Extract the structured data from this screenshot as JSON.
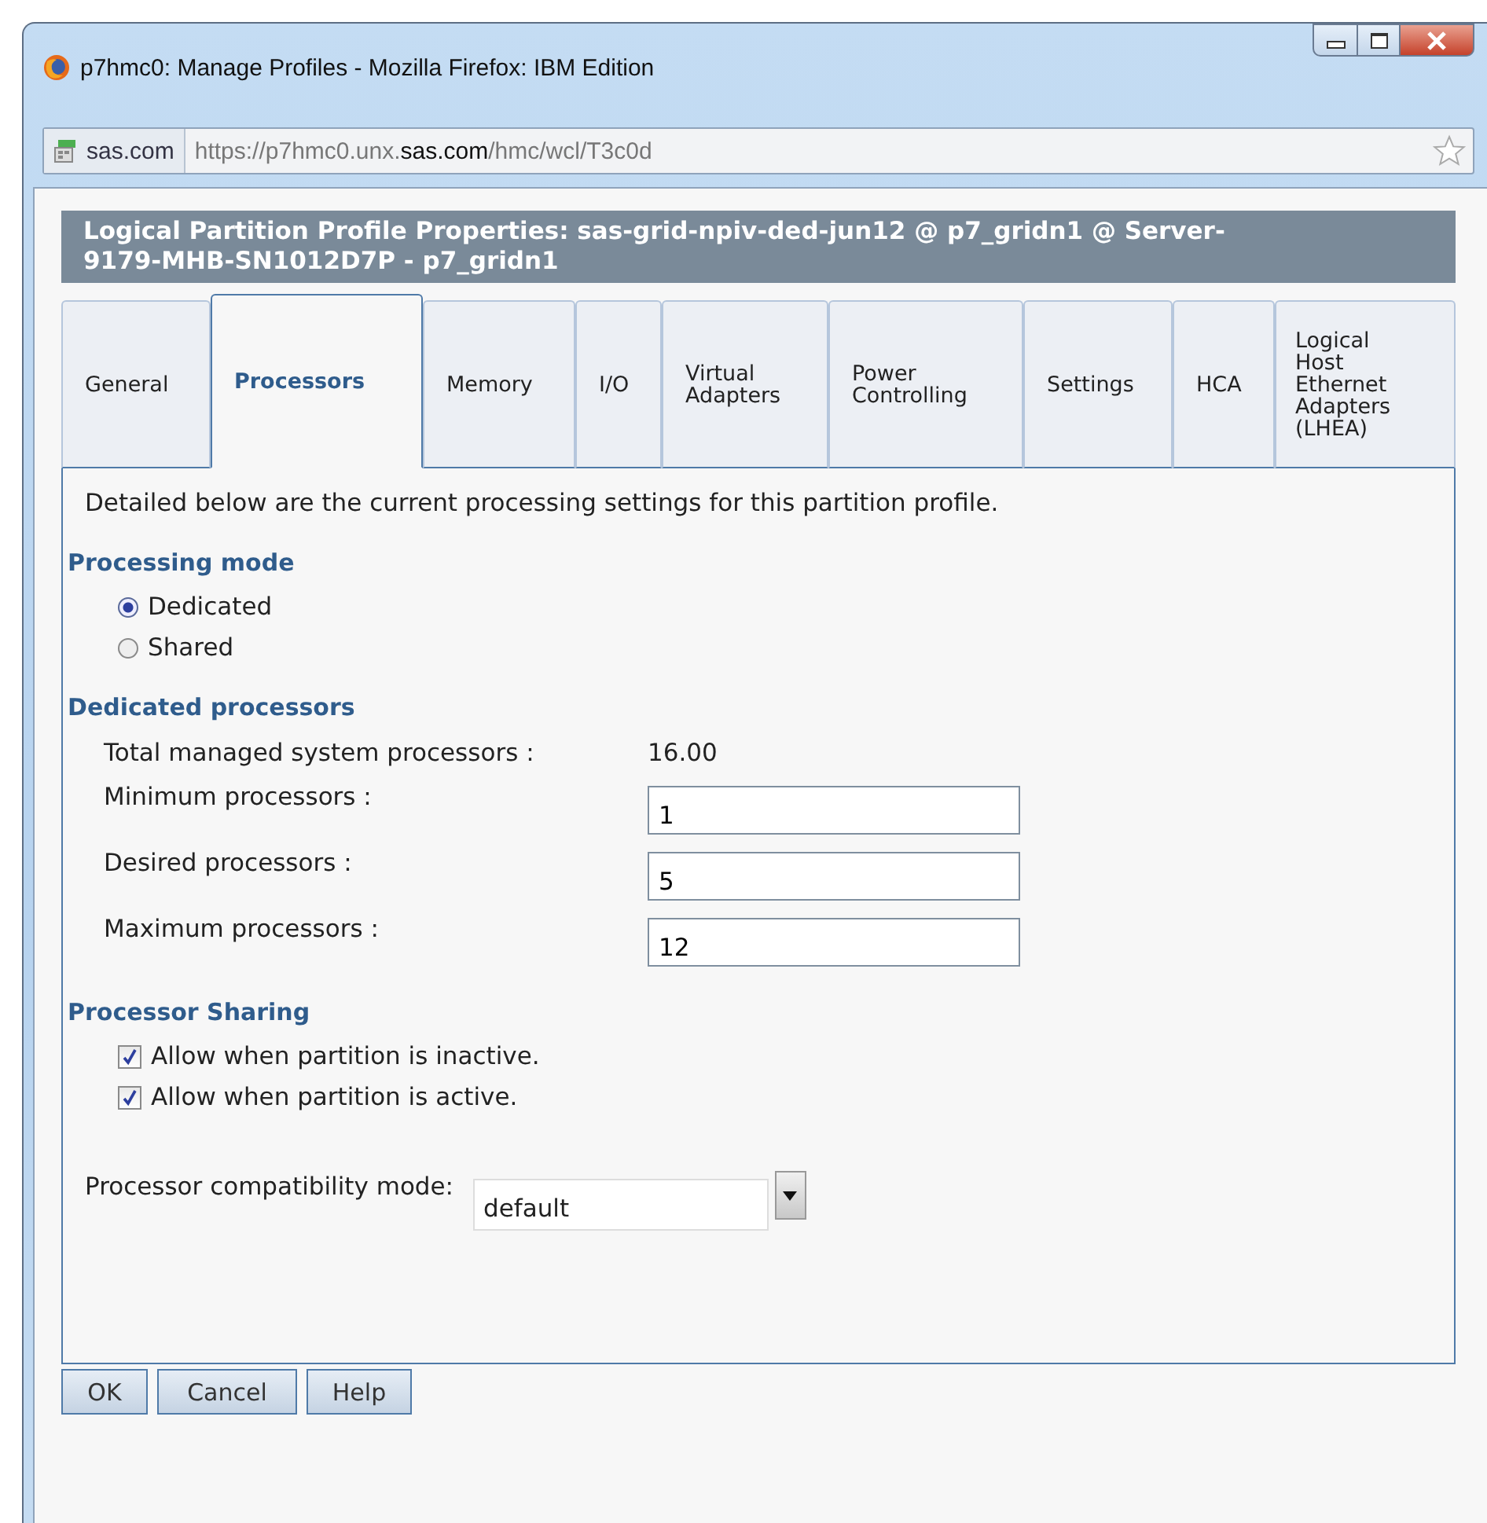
{
  "window": {
    "title": "p7hmc0: Manage Profiles - Mozilla Firefox: IBM Edition"
  },
  "address_bar": {
    "site": "sas.com",
    "url": "https://p7hmc0.unx.**sas.com**/hmc/wcl/T3c0d"
  },
  "header": "Logical Partition Profile Properties: sas-grid-npiv-ded-jun12 @ p7_gridn1 @ Server-9179-MHB-SN1012D7P - p7_gridn1",
  "tabs": [
    {
      "label": "General",
      "selected": false
    },
    {
      "label": "Processors",
      "selected": true
    },
    {
      "label": "Memory",
      "selected": false
    },
    {
      "label": "I/O",
      "selected": false
    },
    {
      "label": "Virtual Adapters",
      "selected": false
    },
    {
      "label": "Power Controlling",
      "selected": false
    },
    {
      "label": "Settings",
      "selected": false
    },
    {
      "label": "HCA",
      "selected": false
    },
    {
      "label": "Logical Host Ethernet Adapters (LHEA)",
      "selected": false
    }
  ],
  "intro": "Detailed below are the current processing settings for this partition profile.",
  "processing_mode": {
    "heading": "Processing mode",
    "options": [
      {
        "label": "Dedicated",
        "selected": true
      },
      {
        "label": "Shared",
        "selected": false
      }
    ]
  },
  "dedicated_processors": {
    "heading": "Dedicated processors",
    "total_label": "Total managed system processors :",
    "total_value": "16.00",
    "fields": [
      {
        "label": "Minimum processors :",
        "value": "1"
      },
      {
        "label": "Desired processors :",
        "value": "5"
      },
      {
        "label": "Maximum processors :",
        "value": "12"
      }
    ]
  },
  "processor_sharing": {
    "heading": "Processor Sharing",
    "options": [
      {
        "label": "Allow when partition is inactive.",
        "checked": true
      },
      {
        "label": "Allow when partition is active.",
        "checked": true
      }
    ]
  },
  "compatibility": {
    "label": "Processor compatibility mode:",
    "value": "default"
  },
  "buttons": [
    "OK",
    "Cancel",
    "Help"
  ]
}
